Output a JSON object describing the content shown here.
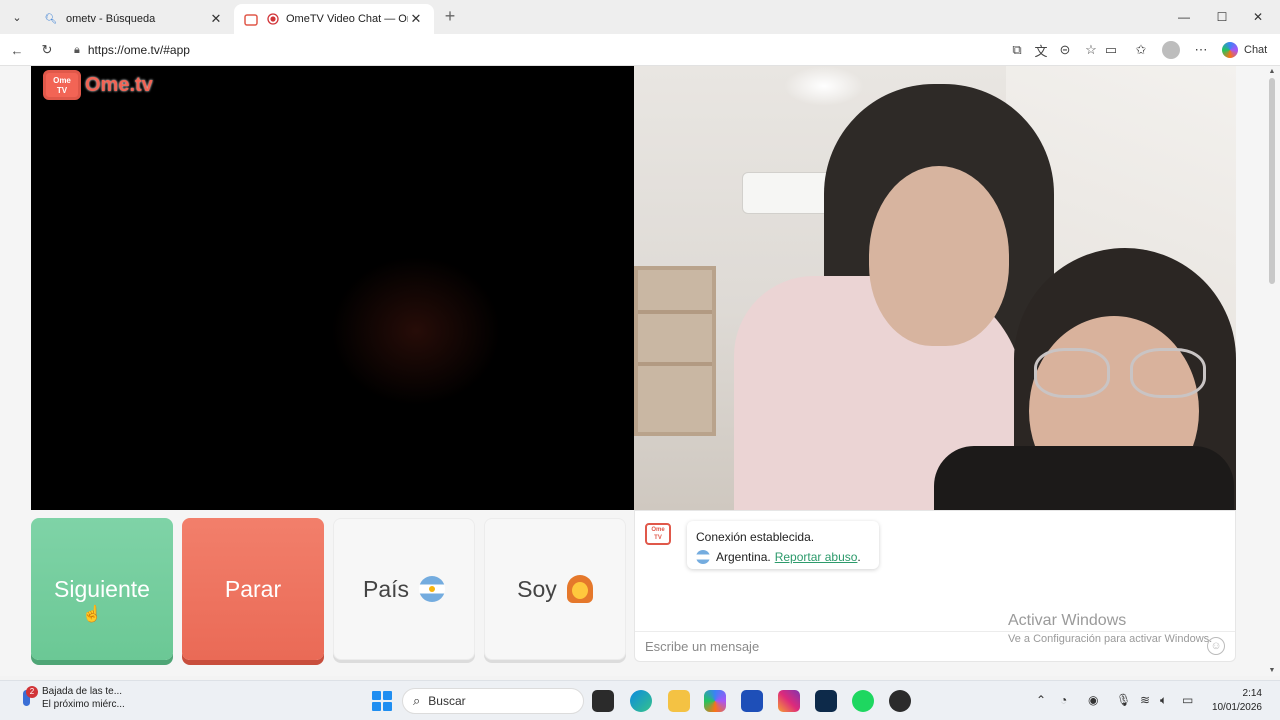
{
  "browser": {
    "tabs": [
      {
        "title": "ometv - Búsqueda",
        "close": "✕"
      },
      {
        "title": "OmeTV Video Chat — Omegle",
        "close": "✕"
      }
    ],
    "new_tab": "+",
    "url": "https://ome.tv/#app",
    "chat_label": "Chat",
    "window_controls": {
      "minimize": "—",
      "maximize": "☐",
      "close": "✕"
    }
  },
  "app": {
    "logo_badge": "Ome\nTV",
    "logo_text": "Ome.tv",
    "buttons": {
      "next": "Siguiente",
      "stop": "Parar",
      "country": "País",
      "gender": "Soy"
    },
    "chat": {
      "logo_badge": "Ome TV",
      "status": "Conexión establecida.",
      "country": "Argentina.",
      "report_link": "Reportar abuso",
      "report_suffix": ".",
      "input_placeholder": "Escribe un mensaje"
    },
    "watermark": {
      "title": "Activar Windows",
      "subtitle": "Ve a Configuración para activar Windows."
    }
  },
  "taskbar": {
    "weather_badge": "2",
    "weather_line1": "Bajada de las te...",
    "weather_line2": "El próximo miérc...",
    "search_placeholder": "Buscar",
    "time": "2:14",
    "date": "10/01/2026"
  },
  "colors": {
    "next_button": "#6bc895",
    "stop_button": "#ea6a56",
    "brand": "#f26455",
    "report_link": "#2c9a6b"
  }
}
